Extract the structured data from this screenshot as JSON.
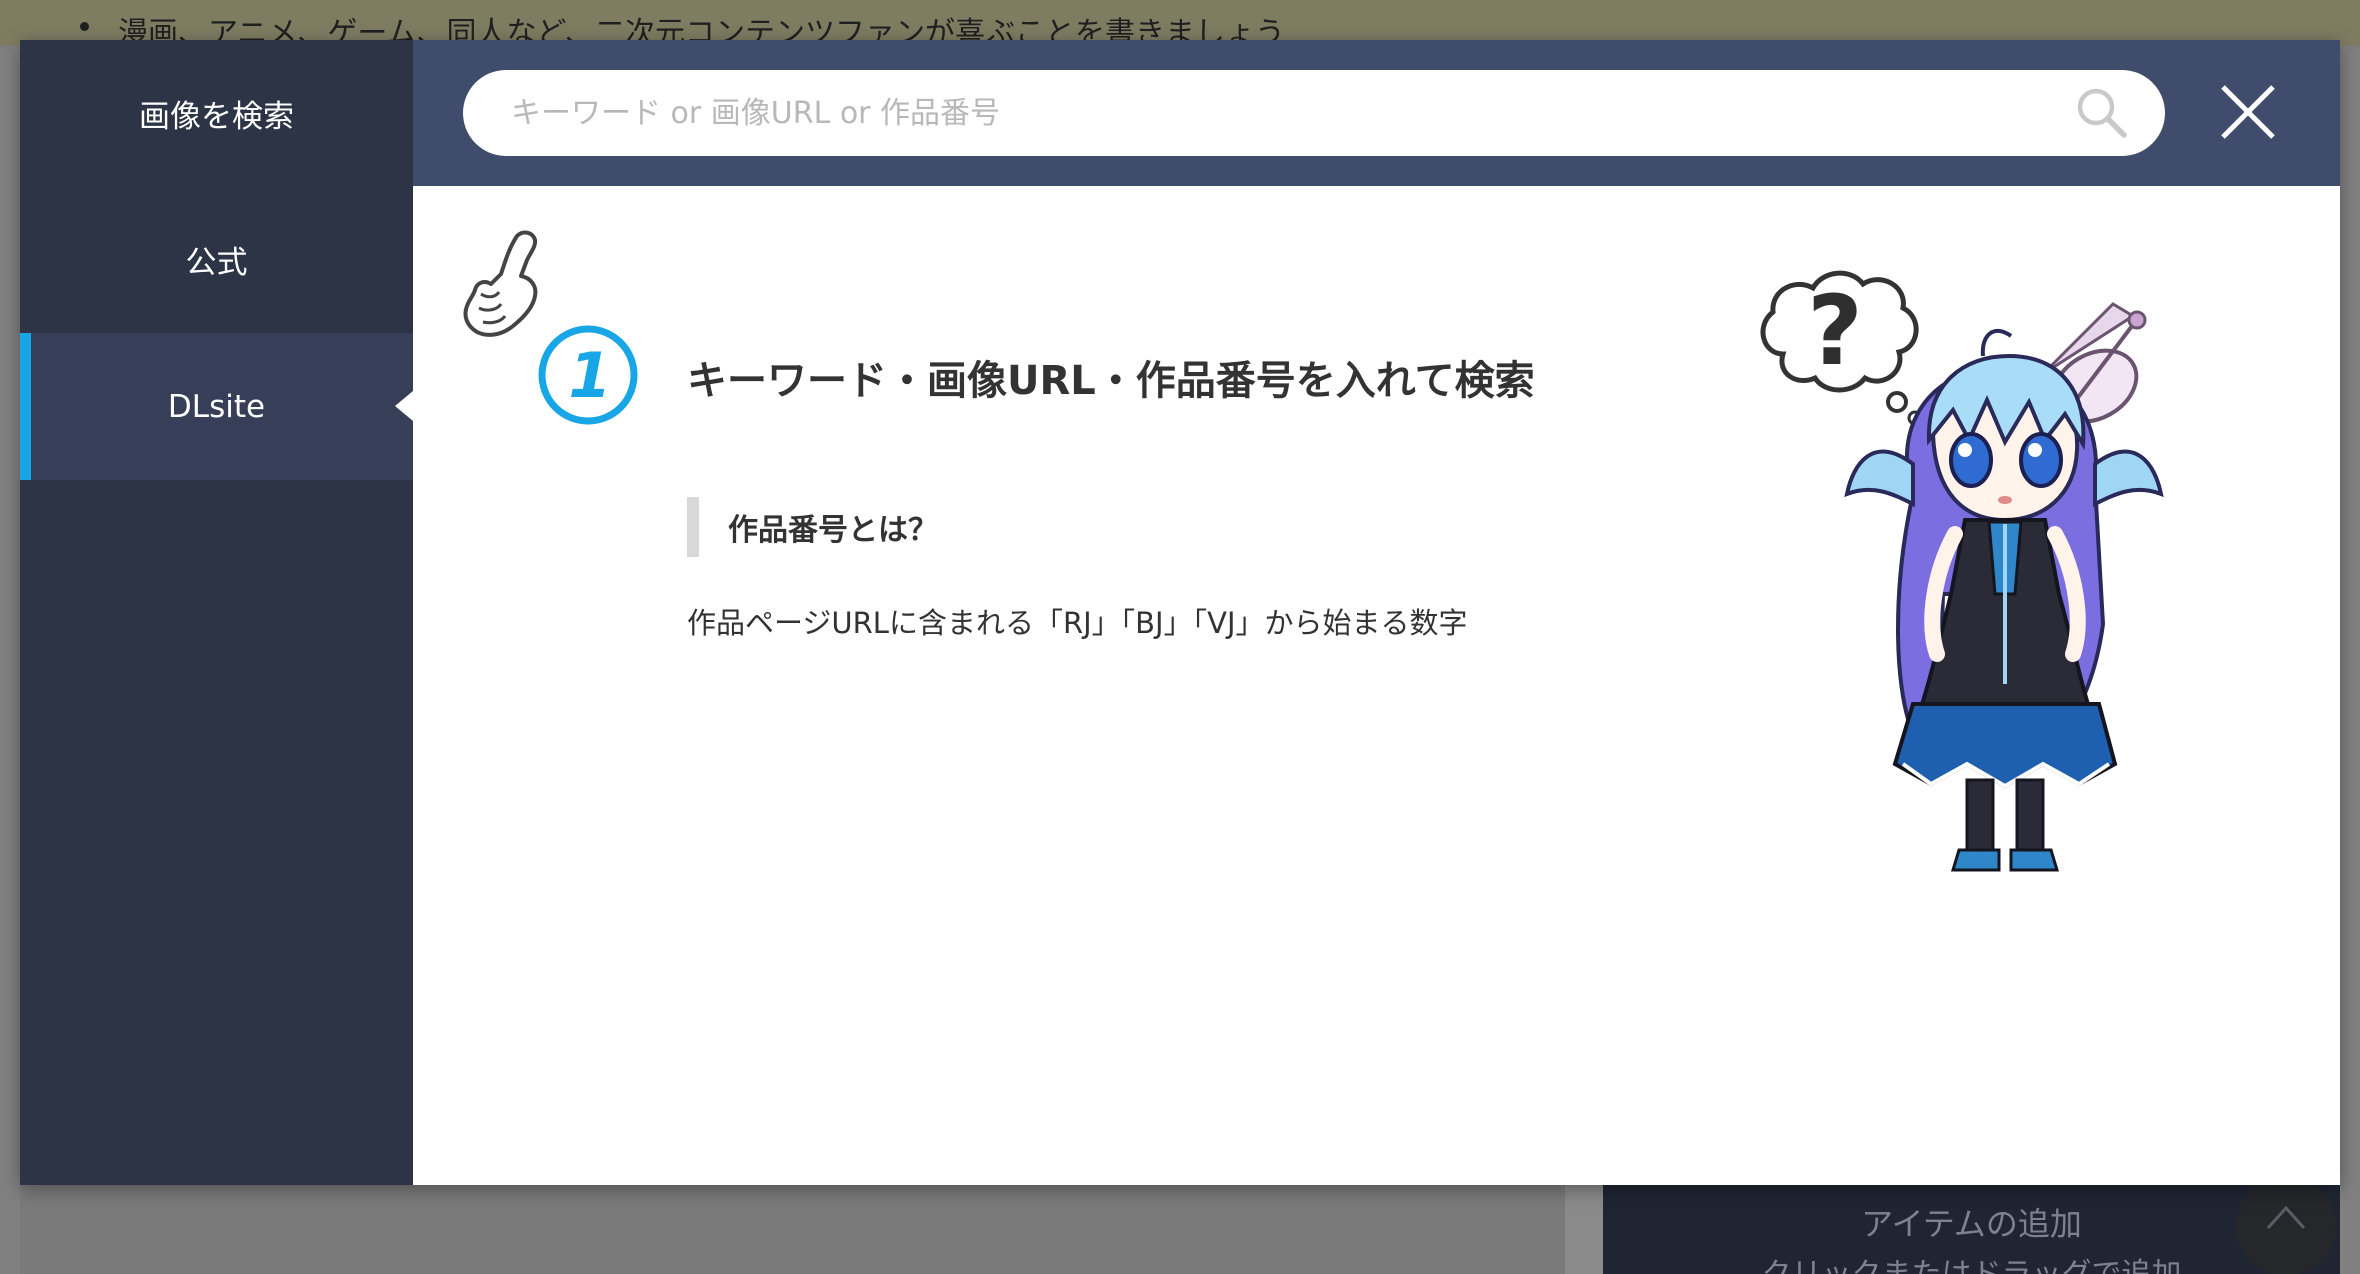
{
  "background": {
    "top_text": "漫画、アニメ、ゲーム、同人など、二次元コンテンツファンが喜ぶことを書きましょう",
    "item_panel": {
      "title": "アイテムの追加",
      "subtitle": "クリックまたはドラッグで追加"
    }
  },
  "sidebar": {
    "title": "画像を検索",
    "items": [
      {
        "label": "公式",
        "active": false
      },
      {
        "label": "DLsite",
        "active": true
      }
    ]
  },
  "search": {
    "value": "",
    "placeholder": "キーワード or 画像URL or 作品番号",
    "icon": "search-icon"
  },
  "close": {
    "icon": "close-icon"
  },
  "guide": {
    "step_number": "1",
    "heading": "キーワード・画像URL・作品番号を入れて検索",
    "subheading": "作品番号とは？",
    "description": "作品ページURLに含まれる「RJ」「BJ」「VJ」から始まる数字"
  },
  "colors": {
    "sidebar_bg": "#2d3446",
    "sidebar_active_bg": "#363f57",
    "accent": "#18a6e6",
    "topbar_bg": "#404c6b",
    "text": "#333333"
  }
}
